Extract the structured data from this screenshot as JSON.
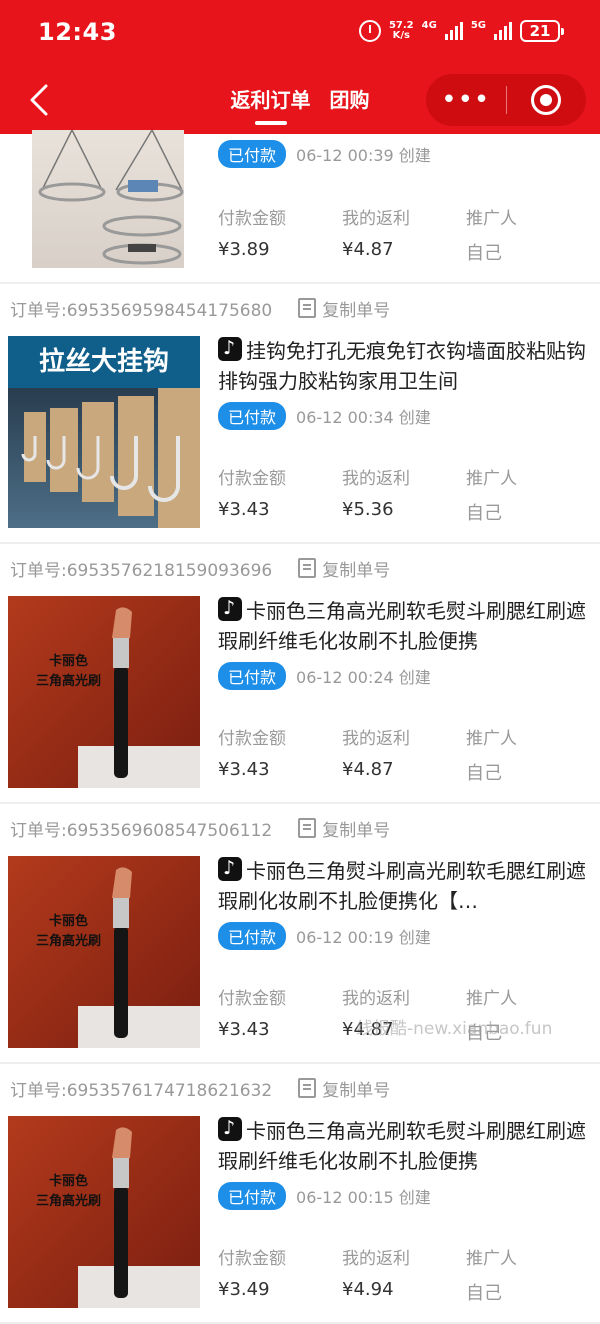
{
  "status_bar": {
    "time": "12:43",
    "speed_top": "57.2",
    "speed_bottom": "K/s",
    "net1": "4G",
    "net2": "5G",
    "battery": "21"
  },
  "header": {
    "tabs": [
      {
        "label": "返利订单",
        "active": true
      },
      {
        "label": "团购",
        "active": false
      }
    ]
  },
  "labels": {
    "pay_amount": "付款金额",
    "my_rebate": "我的返利",
    "promoter": "推广人",
    "copy": "复制单号",
    "status": "已付款"
  },
  "orders": [
    {
      "order_id": "",
      "title": "",
      "created": "06-12 00:39 创建",
      "pay": "¥3.89",
      "rebate": "¥4.87",
      "promoter": "自己",
      "thumb": "drying-rack"
    },
    {
      "order_id": "订单号:6953569598454175680",
      "title": "挂钩免打孔无痕免钉衣钩墙面胶粘贴钩排钩强力胶粘钩家用卫生间",
      "created": "06-12 00:34 创建",
      "pay": "¥3.43",
      "rebate": "¥5.36",
      "promoter": "自己",
      "thumb": "hooks",
      "thumb_text": "拉丝大挂钩"
    },
    {
      "order_id": "订单号:6953576218159093696",
      "title": "卡丽色三角高光刷软毛熨斗刷腮红刷遮瑕刷纤维毛化妆刷不扎脸便携",
      "created": "06-12 00:24 创建",
      "pay": "¥3.43",
      "rebate": "¥4.87",
      "promoter": "自己",
      "thumb": "brush",
      "thumb_text": [
        "卡丽色",
        "三角高光刷"
      ]
    },
    {
      "order_id": "订单号:6953569608547506112",
      "title": "卡丽色三角熨斗刷高光刷软毛腮红刷遮瑕刷化妆刷不扎脸便携化【…",
      "created": "06-12 00:19 创建",
      "pay": "¥3.43",
      "rebate": "¥4.87",
      "promoter": "自己",
      "thumb": "brush",
      "thumb_text": [
        "卡丽色",
        "三角高光刷"
      ]
    },
    {
      "order_id": "订单号:6953576174718621632",
      "title": "卡丽色三角高光刷软毛熨斗刷腮红刷遮瑕刷纤维毛化妆刷不扎脸便携",
      "created": "06-12 00:15 创建",
      "pay": "¥3.49",
      "rebate": "¥4.94",
      "promoter": "自己",
      "thumb": "brush",
      "thumb_text": [
        "卡丽色",
        "三角高光刷"
      ]
    }
  ],
  "watermark": "线报酷-new.xianbao.fun"
}
